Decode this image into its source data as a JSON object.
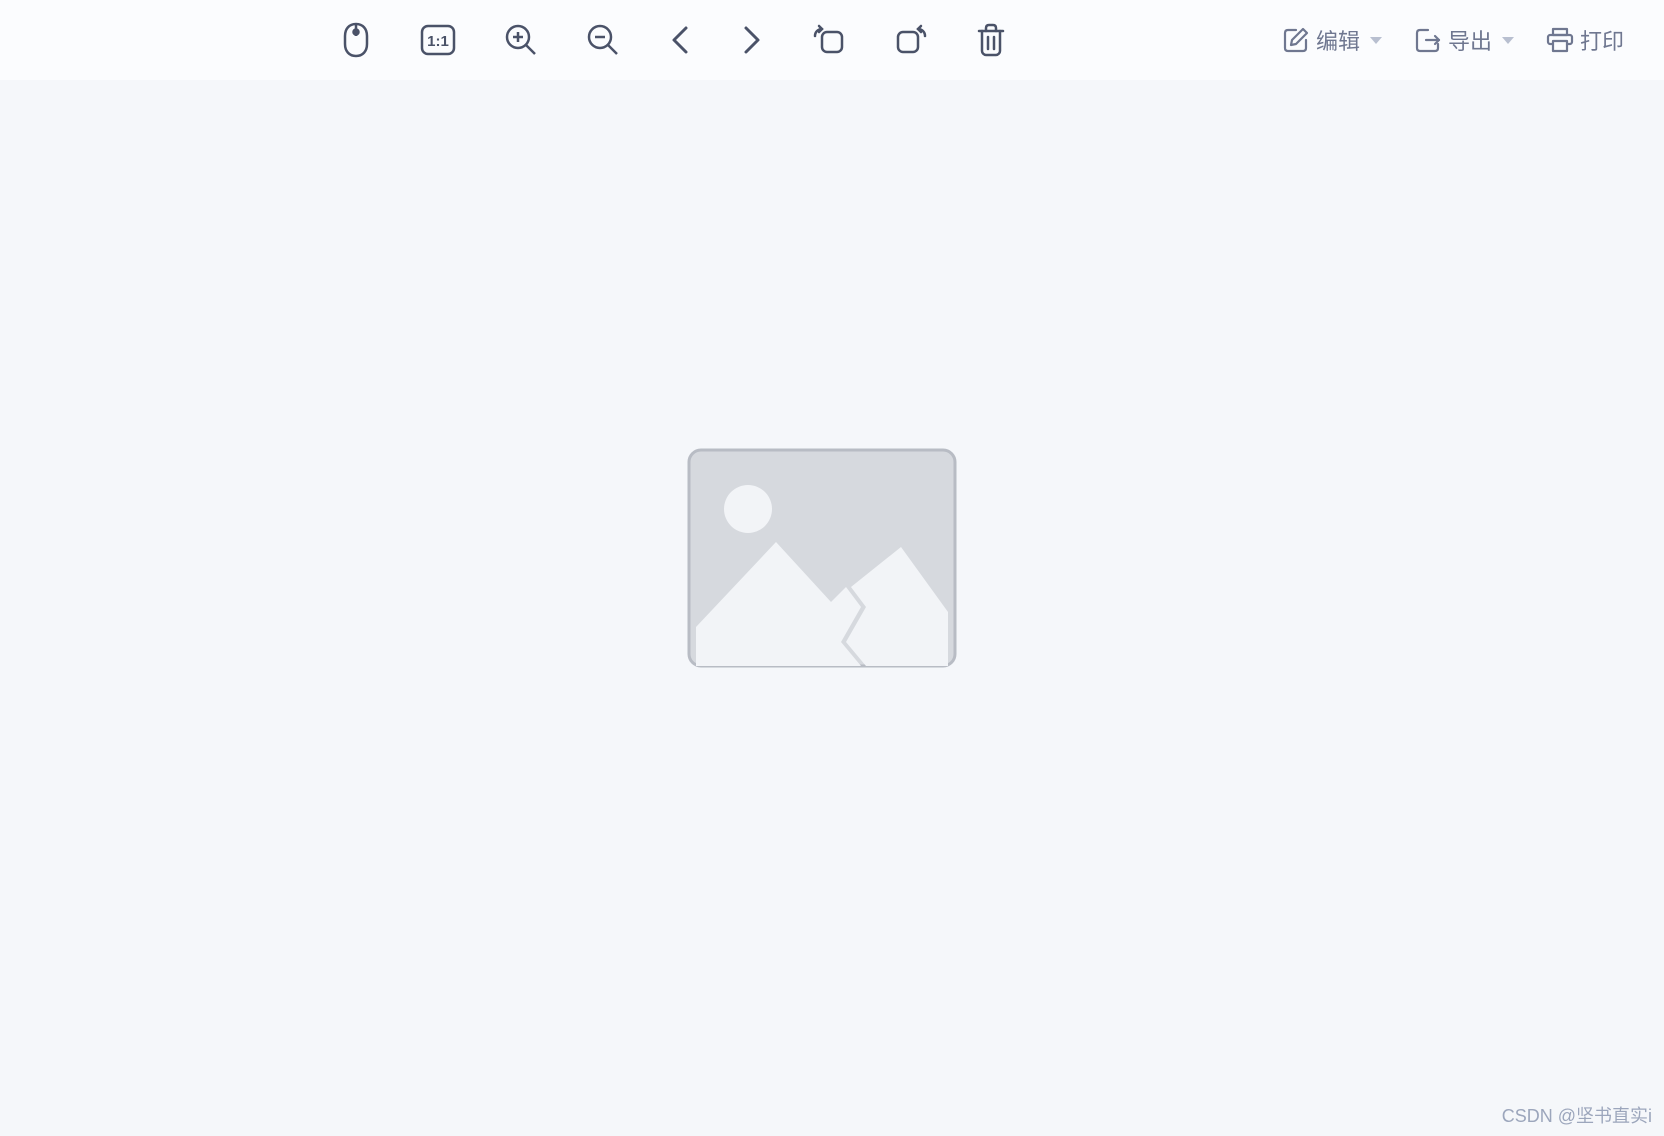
{
  "toolbar": {
    "icons": {
      "mouse": "mouse-icon",
      "fit": "1:1",
      "zoomIn": "zoom-in-icon",
      "zoomOut": "zoom-out-icon",
      "prev": "chevron-left-icon",
      "next": "chevron-right-icon",
      "rotateLeft": "rotate-left-icon",
      "rotateRight": "rotate-right-icon",
      "delete": "trash-icon"
    },
    "actions": {
      "edit": "编辑",
      "export": "导出",
      "print": "打印"
    }
  },
  "canvas": {
    "placeholder": "broken-image"
  },
  "watermark": "CSDN @坚书直实i"
}
